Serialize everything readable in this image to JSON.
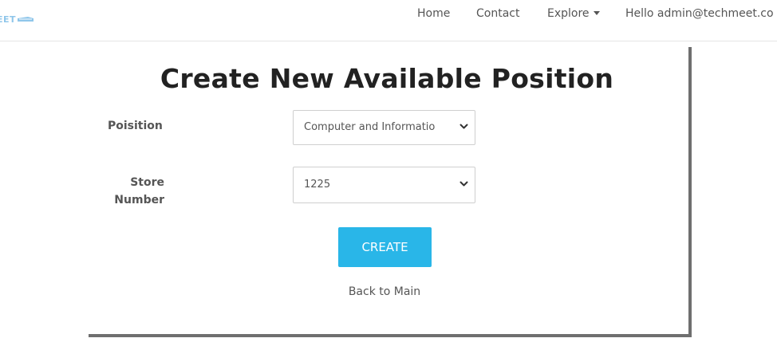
{
  "brand": {
    "text": "EET"
  },
  "nav": {
    "home": "Home",
    "contact": "Contact",
    "explore": "Explore",
    "greeting": "Hello admin@techmeet.co"
  },
  "form": {
    "title": "Create New Available Position",
    "position_label": "Poisition",
    "position_value": "Computer and Informatio",
    "store_label_line1": "Store",
    "store_label_line2": "Number",
    "store_value": "1225",
    "create_label": "CREATE",
    "back_label": "Back to Main"
  },
  "colors": {
    "accent": "#29b6e8",
    "brand": "#8fc6ea",
    "text": "#555555",
    "shadow": "#6f6f6f"
  }
}
